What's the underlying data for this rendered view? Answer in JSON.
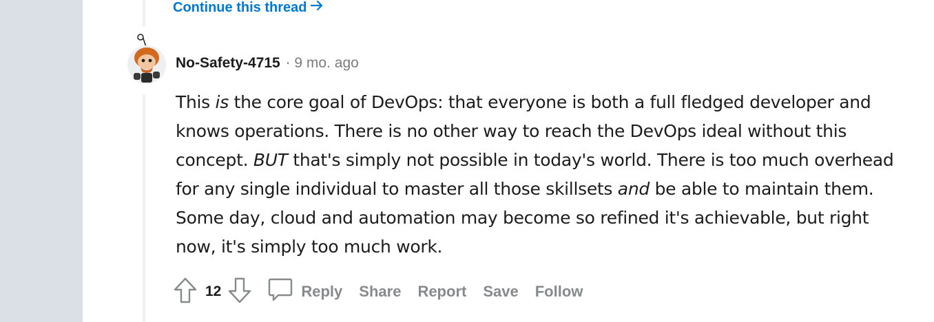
{
  "thread": {
    "continue_label": "Continue this thread"
  },
  "comment": {
    "author": "No-Safety-4715",
    "separator": "·",
    "time": "9 mo. ago",
    "body": {
      "s1a": "This ",
      "s1b": "is",
      "s1c": " the core goal of DevOps: that everyone is both a full fledged developer and knows operations. There is no other way to reach the DevOps ideal without this concept. ",
      "s1d": "BUT",
      "s1e": " that's simply not possible in today's world. There is too much overhead for any single individual to master all those skillsets ",
      "s1f": "and",
      "s1g": " be able to maintain them. Some day, cloud and automation may become so refined it's achievable, but right now, it's simply too much work."
    },
    "score": "12",
    "actions": {
      "reply": "Reply",
      "share": "Share",
      "report": "Report",
      "save": "Save",
      "follow": "Follow"
    }
  },
  "icons": {
    "continue": "arrow-right-icon",
    "upvote": "arrow-up-outline-icon",
    "downvote": "arrow-down-outline-icon",
    "reply": "speech-bubble-icon"
  },
  "colors": {
    "link": "#0079d3",
    "muted": "#878a8c",
    "gutter": "#dae0e6",
    "thread_line": "#edeff1"
  }
}
